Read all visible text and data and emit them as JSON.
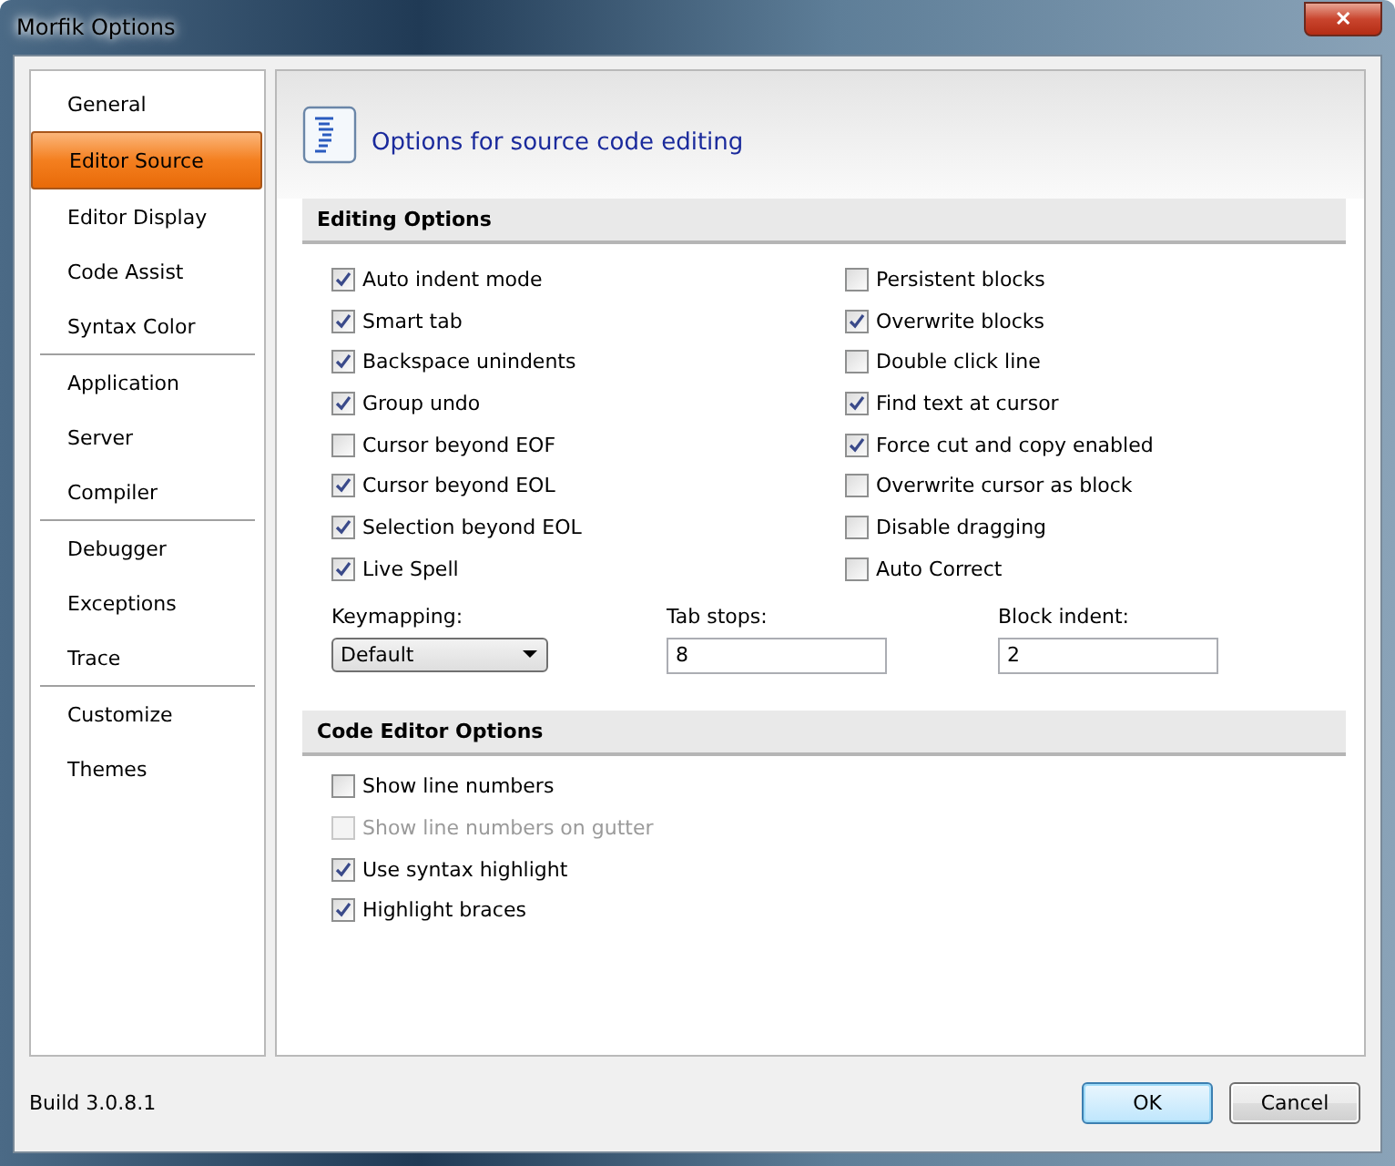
{
  "window": {
    "title": "Morfik Options",
    "close": "✕"
  },
  "sidebar": {
    "groups": [
      {
        "items": [
          {
            "label": "General",
            "selected": false
          },
          {
            "label": "Editor Source",
            "selected": true
          },
          {
            "label": "Editor Display",
            "selected": false
          },
          {
            "label": "Code Assist",
            "selected": false
          },
          {
            "label": "Syntax Color",
            "selected": false
          }
        ]
      },
      {
        "items": [
          {
            "label": "Application",
            "selected": false
          },
          {
            "label": "Server",
            "selected": false
          },
          {
            "label": "Compiler",
            "selected": false
          }
        ]
      },
      {
        "items": [
          {
            "label": "Debugger",
            "selected": false
          },
          {
            "label": "Exceptions",
            "selected": false
          },
          {
            "label": "Trace",
            "selected": false
          }
        ]
      },
      {
        "items": [
          {
            "label": "Customize",
            "selected": false
          },
          {
            "label": "Themes",
            "selected": false
          }
        ]
      }
    ]
  },
  "header": {
    "title": "Options for source code editing"
  },
  "editing_options": {
    "title": "Editing Options",
    "left": [
      {
        "label": "Auto indent mode",
        "checked": true
      },
      {
        "label": "Smart tab",
        "checked": true
      },
      {
        "label": "Backspace unindents",
        "checked": true
      },
      {
        "label": "Group undo",
        "checked": true
      },
      {
        "label": "Cursor beyond EOF",
        "checked": false
      },
      {
        "label": "Cursor beyond EOL",
        "checked": true
      },
      {
        "label": "Selection beyond EOL",
        "checked": true
      },
      {
        "label": "Live Spell",
        "checked": true
      }
    ],
    "right": [
      {
        "label": "Persistent blocks",
        "checked": false
      },
      {
        "label": "Overwrite blocks",
        "checked": true
      },
      {
        "label": "Double click line",
        "checked": false
      },
      {
        "label": "Find text at cursor",
        "checked": true
      },
      {
        "label": "Force cut and copy enabled",
        "checked": true
      },
      {
        "label": "Overwrite cursor as block",
        "checked": false
      },
      {
        "label": "Disable dragging",
        "checked": false
      },
      {
        "label": "Auto Correct",
        "checked": false
      }
    ],
    "fields": [
      {
        "kind": "dropdown",
        "label": "Keymapping:",
        "value": "Default"
      },
      {
        "kind": "text",
        "label": "Tab stops:",
        "value": "8"
      },
      {
        "kind": "text",
        "label": "Block indent:",
        "value": "2"
      }
    ]
  },
  "code_editor_options": {
    "title": "Code Editor Options",
    "items": [
      {
        "label": "Show line numbers",
        "checked": false,
        "disabled": false
      },
      {
        "label": "Show line numbers on gutter",
        "checked": false,
        "disabled": true
      },
      {
        "label": "Use syntax highlight",
        "checked": true,
        "disabled": false
      },
      {
        "label": "Highlight braces",
        "checked": true,
        "disabled": false
      }
    ]
  },
  "footer": {
    "build": "Build 3.0.8.1",
    "buttons": [
      {
        "label": "OK",
        "default": true
      },
      {
        "label": "Cancel",
        "default": false
      }
    ]
  }
}
